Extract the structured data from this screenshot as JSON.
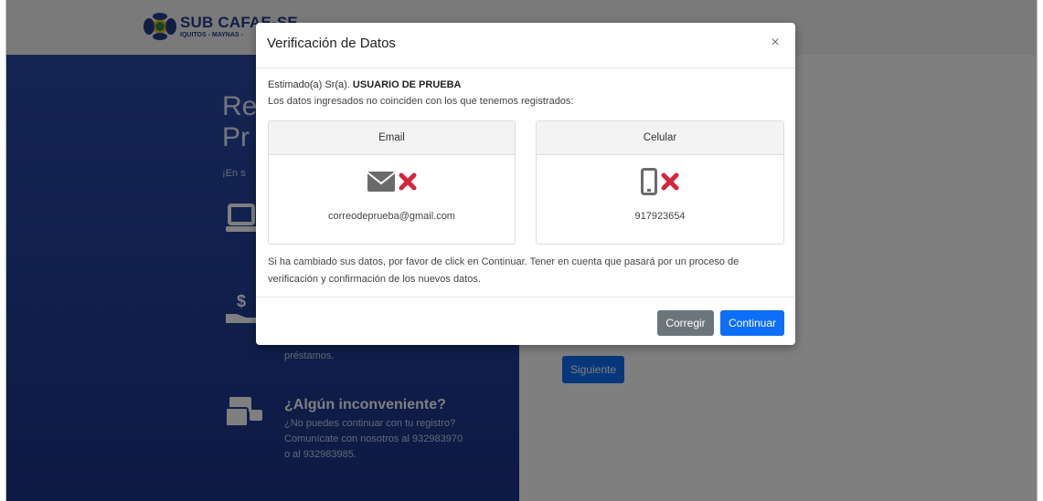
{
  "brand": {
    "title": "SUB CAFAE-SE",
    "subtitle": "IQUITOS - MAYNAS - "
  },
  "hero": {
    "title_line1": "Re",
    "title_line2": "Pr",
    "subtitle": "¡En s"
  },
  "features": [
    {
      "icon": "laptop-icon"
    },
    {
      "icon": "money-hand-icon",
      "text_tail": "préstamos."
    },
    {
      "icon": "support-chat-icon",
      "title": "¿Algún inconveniente?",
      "line1": "¿No puedes continuar con tu registro?",
      "line2": "Comunícate con nosotros al 932983970",
      "line3": "o al 932983985."
    }
  ],
  "form": {
    "next_label": "Siguiente"
  },
  "modal": {
    "title": "Verificación de Datos",
    "close_symbol": "×",
    "greeting_prefix": "Estimado(a) Sr(a). ",
    "user_name": "USUARIO DE PRUEBA",
    "mismatch_text": "Los datos ingresados no coinciden con los que tenemos registrados:",
    "email_card": {
      "header": "Email",
      "value": "correodeprueba@gmail.com",
      "icon": "envelope-icon",
      "status_icon": "x-mark-icon"
    },
    "phone_card": {
      "header": "Celular",
      "value": "917923654",
      "icon": "mobile-phone-icon",
      "status_icon": "x-mark-icon"
    },
    "notice": "Si ha cambiado sus datos, por favor de click en Continuar. Tener en cuenta que pasará por un proceso de verificación y confirmación de los nuevos datos.",
    "buttons": {
      "correct": "Corregir",
      "continue": "Continuar"
    }
  },
  "colors": {
    "brand_blue": "#243c8c",
    "panel_blue": "#213f98",
    "primary": "#0d6ef7",
    "secondary": "#6c757d",
    "error_red": "#d6263b"
  }
}
